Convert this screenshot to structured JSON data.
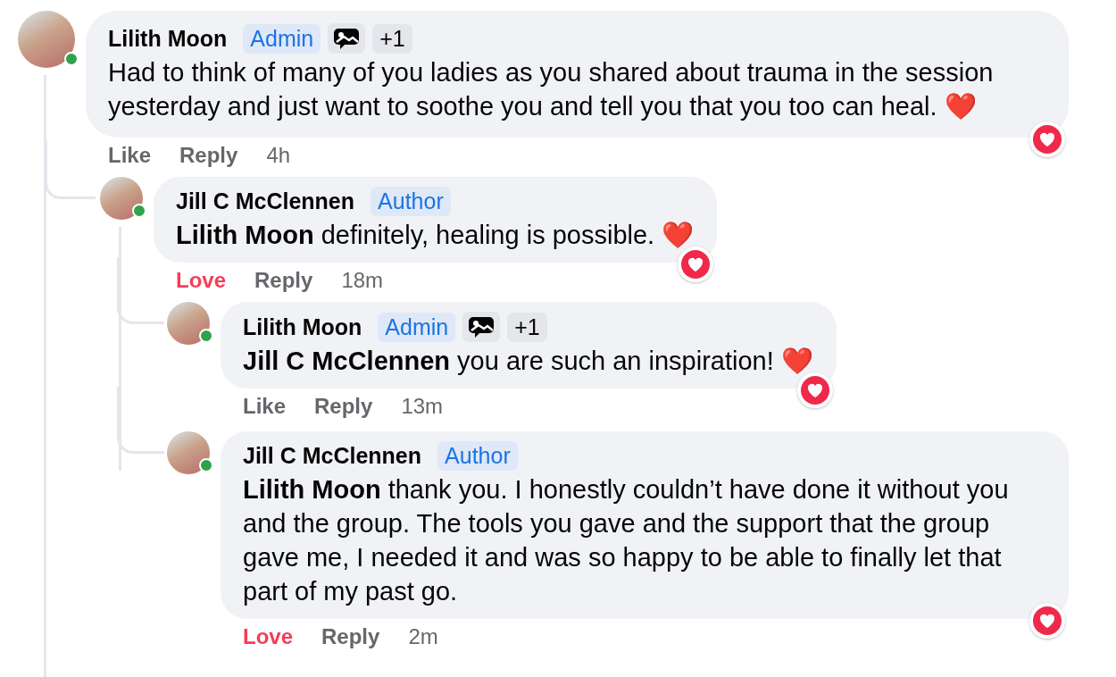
{
  "comments": [
    {
      "author": "Lilith Moon",
      "online": true,
      "badges": [
        {
          "kind": "role",
          "label": "Admin"
        },
        {
          "kind": "icon"
        },
        {
          "kind": "count",
          "label": "+1"
        }
      ],
      "text": "Had to think of many of you ladies as you shared about trauma in the session yesterday and just want to soothe you and tell you that you too can heal. ❤️",
      "reacted": true,
      "actions": [
        {
          "label": "Like",
          "active": false
        },
        {
          "label": "Reply",
          "active": false
        }
      ],
      "time": "4h",
      "children": [
        {
          "author": "Jill C McClennen",
          "online": true,
          "badges": [
            {
              "kind": "role",
              "label": "Author"
            }
          ],
          "text": "**Lilith Moon** definitely, healing is possible. ❤️",
          "reacted": true,
          "actions": [
            {
              "label": "Love",
              "active": true
            },
            {
              "label": "Reply",
              "active": false
            }
          ],
          "time": "18m",
          "children": [
            {
              "author": "Lilith Moon",
              "online": true,
              "badges": [
                {
                  "kind": "role",
                  "label": "Admin"
                },
                {
                  "kind": "icon"
                },
                {
                  "kind": "count",
                  "label": "+1"
                }
              ],
              "text": "**Jill C McClennen** you are such an inspiration! ❤️",
              "reacted": true,
              "actions": [
                {
                  "label": "Like",
                  "active": false
                },
                {
                  "label": "Reply",
                  "active": false
                }
              ],
              "time": "13m"
            },
            {
              "author": "Jill C McClennen",
              "online": true,
              "badges": [
                {
                  "kind": "role",
                  "label": "Author"
                }
              ],
              "text": "**Lilith Moon** thank you. I honestly couldn’t have done it without you and the group. The tools you gave and the support that the group gave me, I needed it and was so happy to be able to finally let that part of my past go.",
              "reacted": true,
              "actions": [
                {
                  "label": "Love",
                  "active": true
                },
                {
                  "label": "Reply",
                  "active": false
                }
              ],
              "time": "2m"
            }
          ]
        }
      ]
    }
  ]
}
